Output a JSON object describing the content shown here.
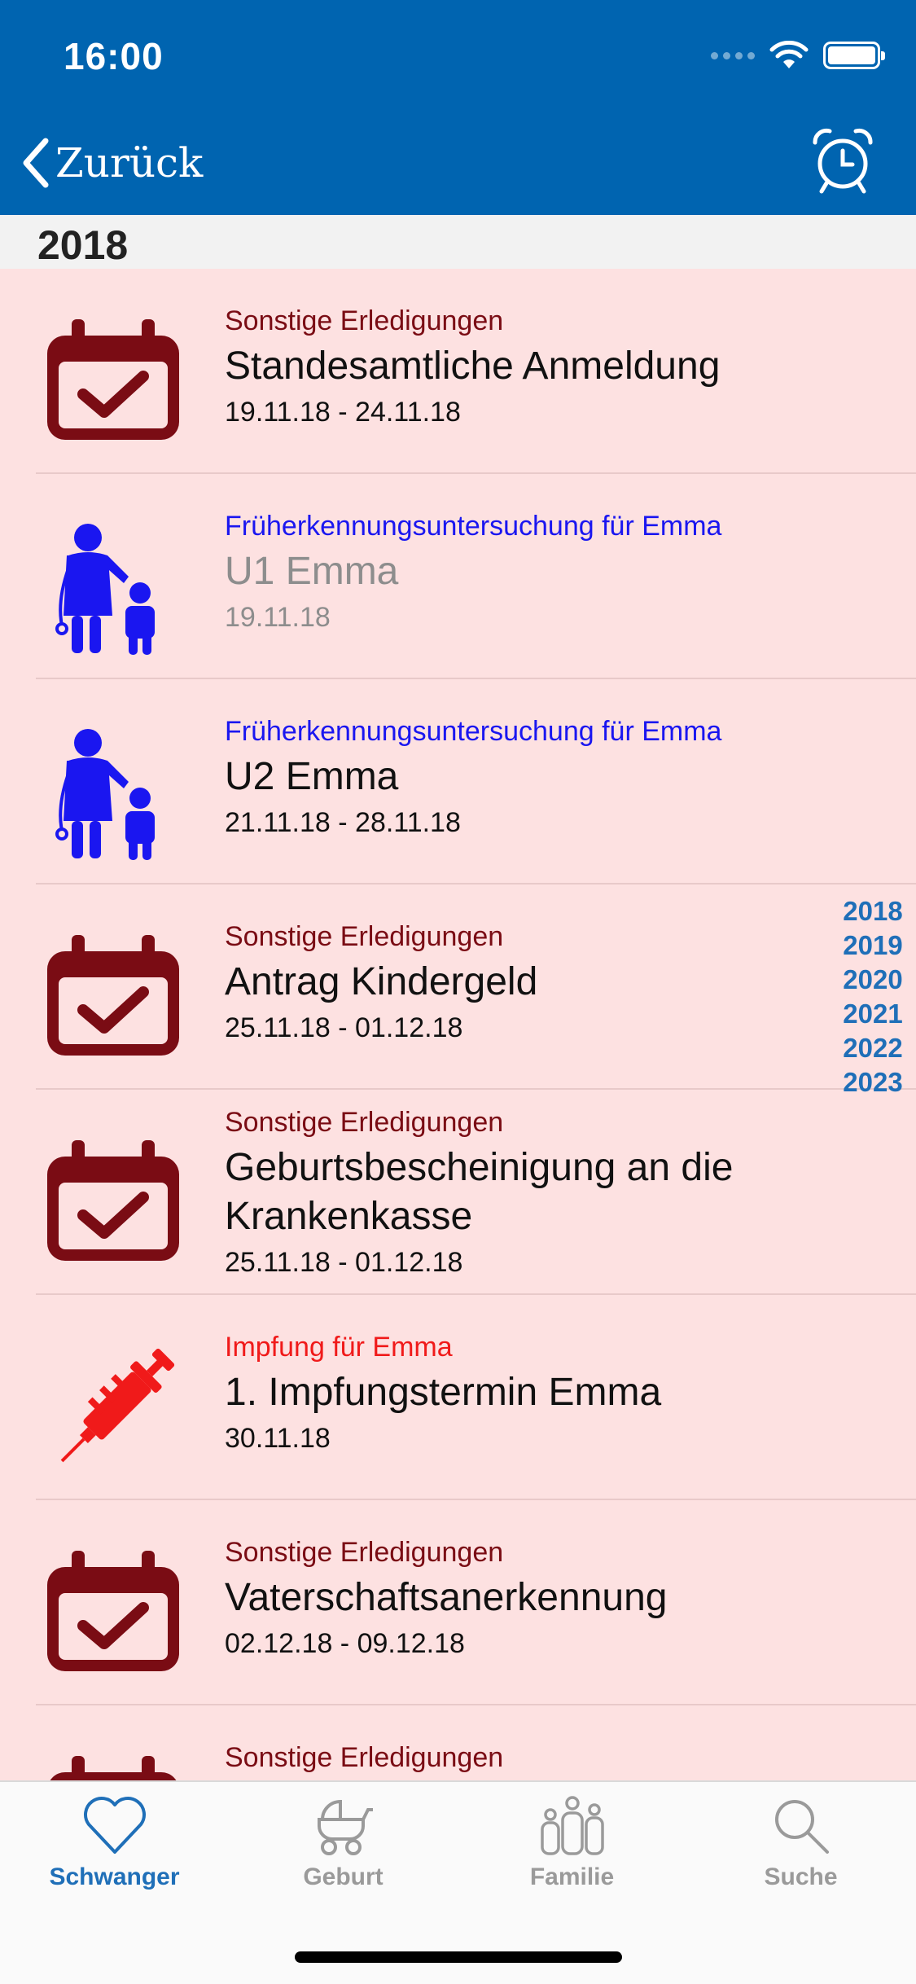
{
  "status": {
    "time": "16:00"
  },
  "nav": {
    "back_label": "Zurück",
    "alarm_icon": "alarm-clock-icon"
  },
  "section": {
    "title": "2018"
  },
  "colors": {
    "bar": "#0064b0",
    "errand": "#7a0c14",
    "checkup": "#1a16f0",
    "vaccine": "#f01a1a",
    "list_bg": "#fde1e1"
  },
  "items": [
    {
      "category": "Sonstige Erledigungen",
      "title": "Standesamtliche Anmeldung",
      "date": "19.11.18 - 24.11.18",
      "icon": "calendar-check-icon"
    },
    {
      "category": "Früherkennungsuntersuchung für Emma",
      "title": "U1 Emma",
      "date": "19.11.18",
      "icon": "doctor-child-icon"
    },
    {
      "category": "Früherkennungsuntersuchung für Emma",
      "title": "U2 Emma",
      "date": "21.11.18 - 28.11.18",
      "icon": "doctor-child-icon"
    },
    {
      "category": "Sonstige Erledigungen",
      "title": "Antrag Kindergeld",
      "date": "25.11.18 - 01.12.18",
      "icon": "calendar-check-icon"
    },
    {
      "category": "Sonstige Erledigungen",
      "title": "Geburtsbescheinigung an die Krankenkasse",
      "date": "25.11.18 - 01.12.18",
      "icon": "calendar-check-icon"
    },
    {
      "category": "Impfung für Emma",
      "title": "1. Impfungstermin Emma",
      "date": "30.11.18",
      "icon": "syringe-icon"
    },
    {
      "category": "Sonstige Erledigungen",
      "title": "Vaterschaftsanerkennung",
      "date": "02.12.18 - 09.12.18",
      "icon": "calendar-check-icon"
    },
    {
      "category": "Sonstige Erledigungen",
      "icon": "calendar-check-icon"
    }
  ],
  "year_index": [
    "2018",
    "2019",
    "2020",
    "2021",
    "2022",
    "2023"
  ],
  "tabs": [
    {
      "label": "Schwanger",
      "icon": "heart-icon"
    },
    {
      "label": "Geburt",
      "icon": "stroller-icon"
    },
    {
      "label": "Familie",
      "icon": "family-icon"
    },
    {
      "label": "Suche",
      "icon": "search-icon"
    }
  ]
}
